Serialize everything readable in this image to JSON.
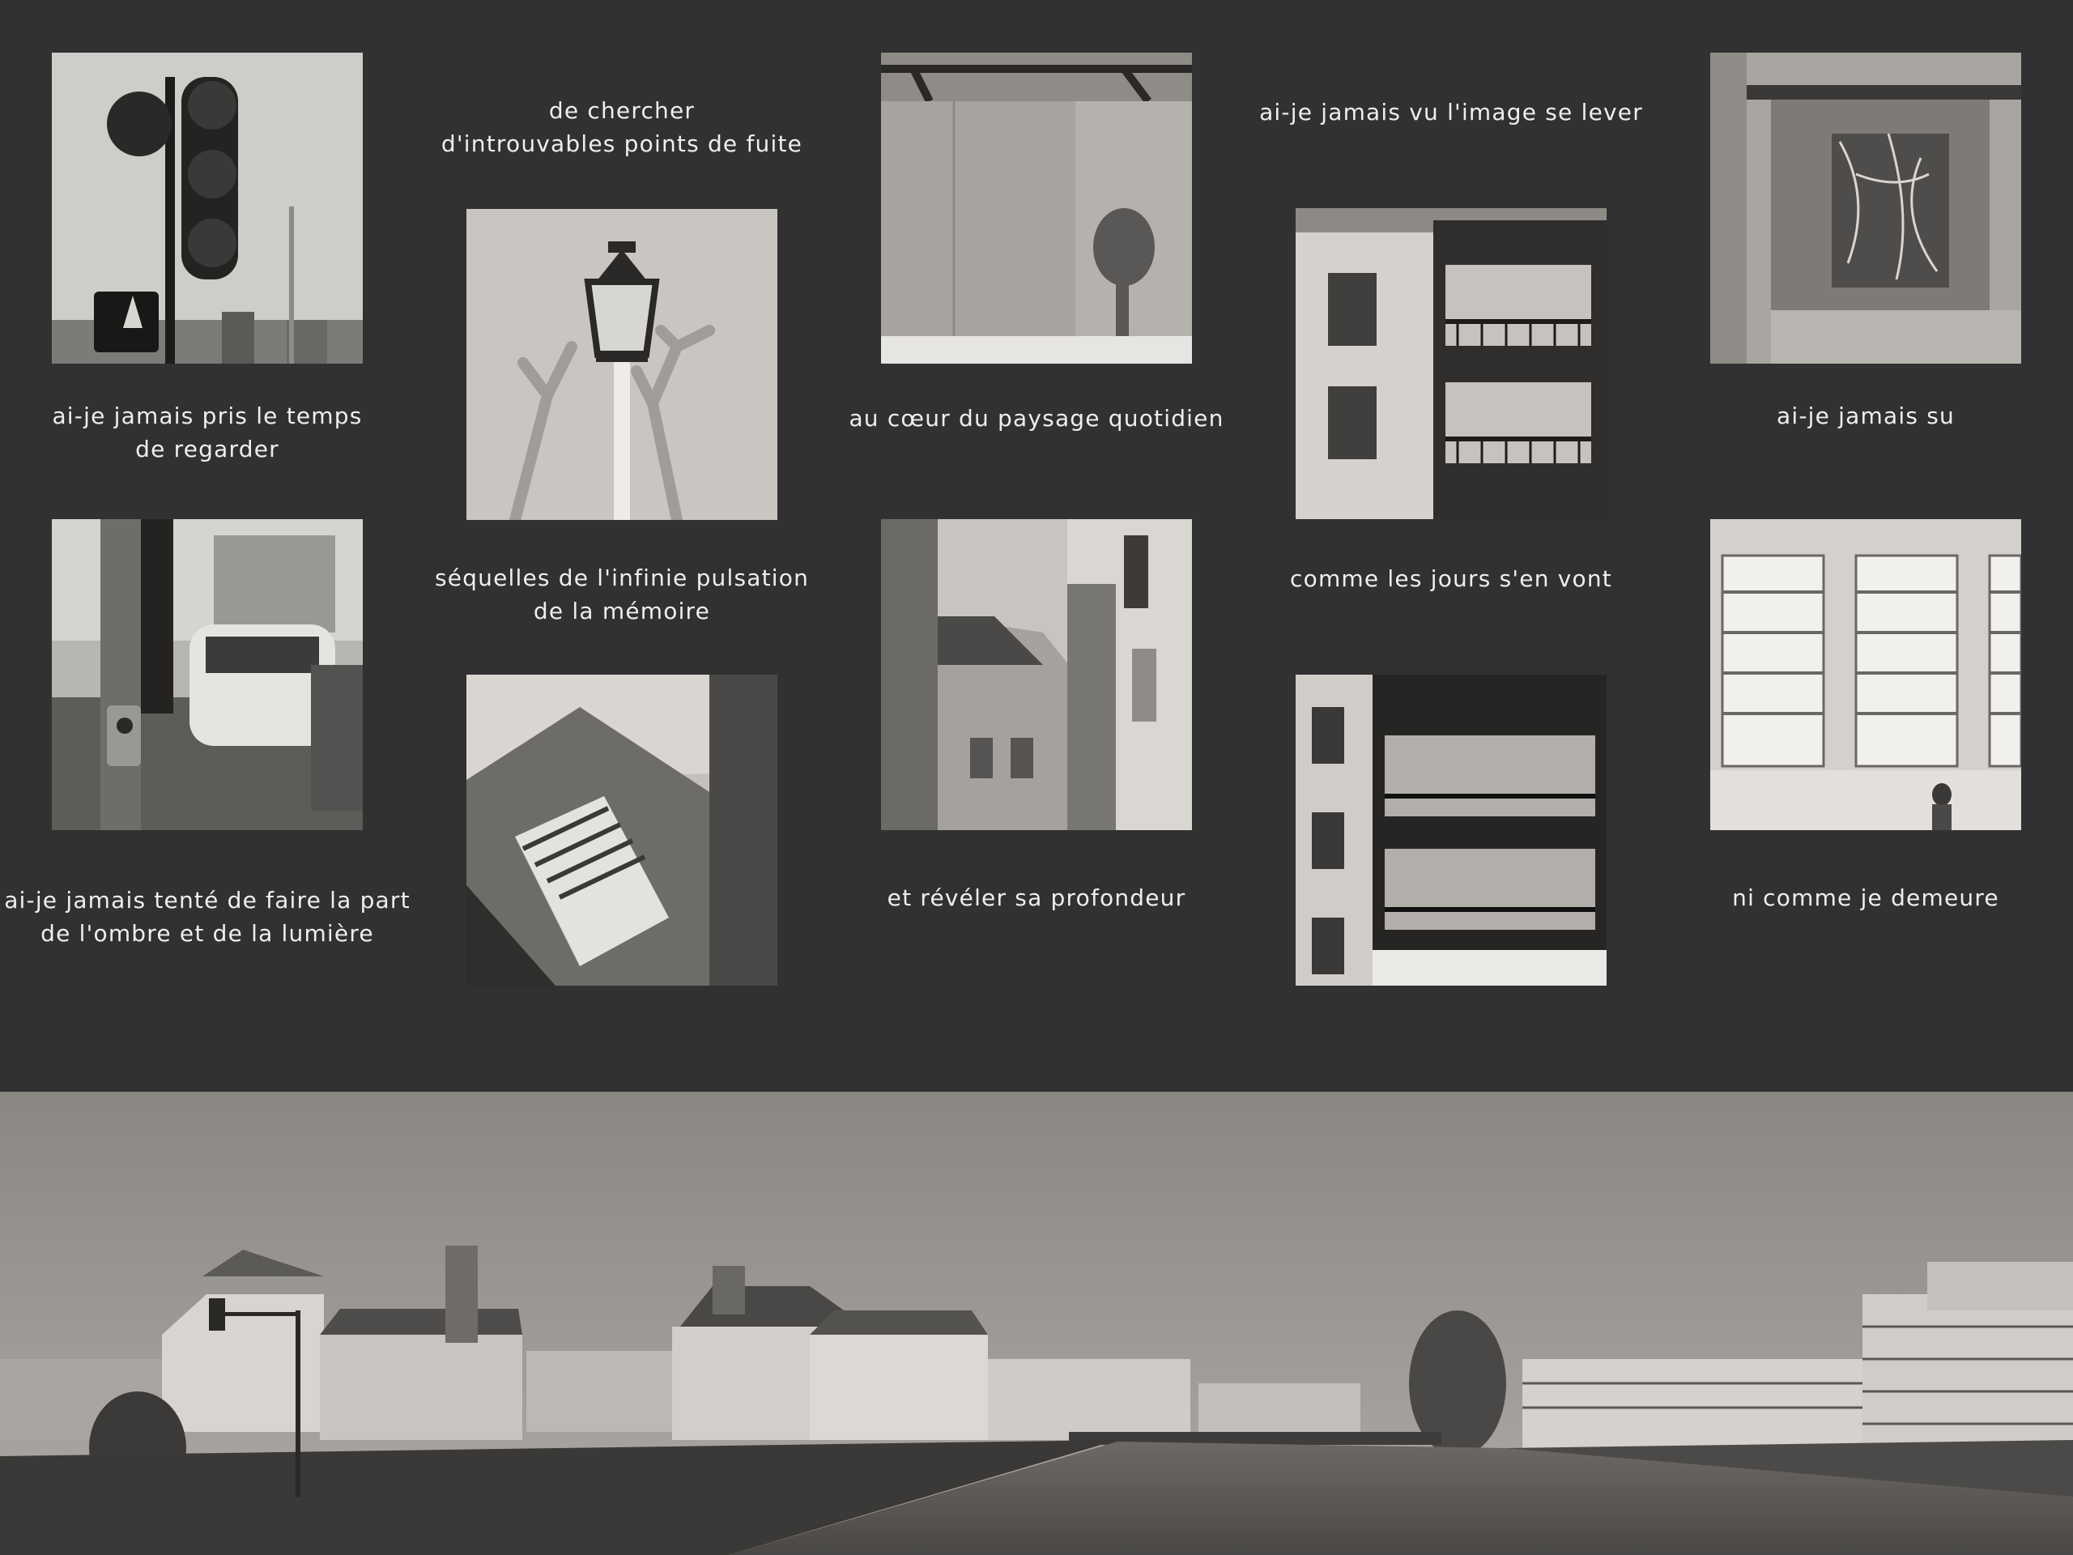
{
  "captions": {
    "c1": [
      "ai-je jamais pris le temps",
      "de regarder"
    ],
    "c2": [
      "de chercher",
      "d'introuvables points de fuite"
    ],
    "c3": [
      "au cœur du paysage quotidien"
    ],
    "c4": [
      "ai-je jamais vu l'image se lever"
    ],
    "c5": [
      "ai-je jamais su"
    ],
    "c6": [
      "ai-je jamais tenté de faire la part",
      "de l'ombre et de la lumière"
    ],
    "c7": [
      "séquelles de l'infinie pulsation",
      "de la mémoire"
    ],
    "c8": [
      "et révéler sa profondeur"
    ],
    "c9": [
      "comme les jours s'en vont"
    ],
    "c10": [
      "ni comme je demeure"
    ]
  },
  "photos": [
    {
      "id": "traffic-light",
      "subject": "traffic light with pedestrian signal"
    },
    {
      "id": "street-lamp",
      "subject": "street lamp between pruned trees"
    },
    {
      "id": "wall-shadow",
      "subject": "shadow of a lamp on a wall"
    },
    {
      "id": "apartment-balconies",
      "subject": "apartment facade with balconies"
    },
    {
      "id": "weathered-wall",
      "subject": "weathered wall with dried vines"
    },
    {
      "id": "street-car",
      "subject": "pedestrian button post and car on street"
    },
    {
      "id": "stairs-shadow",
      "subject": "shutters and stairs in light and shadow"
    },
    {
      "id": "courtyard",
      "subject": "buildings around a courtyard"
    },
    {
      "id": "balcony-tower",
      "subject": "stacked balconies of a building"
    },
    {
      "id": "barred-windows",
      "subject": "barred windows with passer-by"
    },
    {
      "id": "river-panorama",
      "subject": "town panorama along the river"
    }
  ],
  "colors": {
    "background": "#313132",
    "caption": "#eeeeee"
  }
}
